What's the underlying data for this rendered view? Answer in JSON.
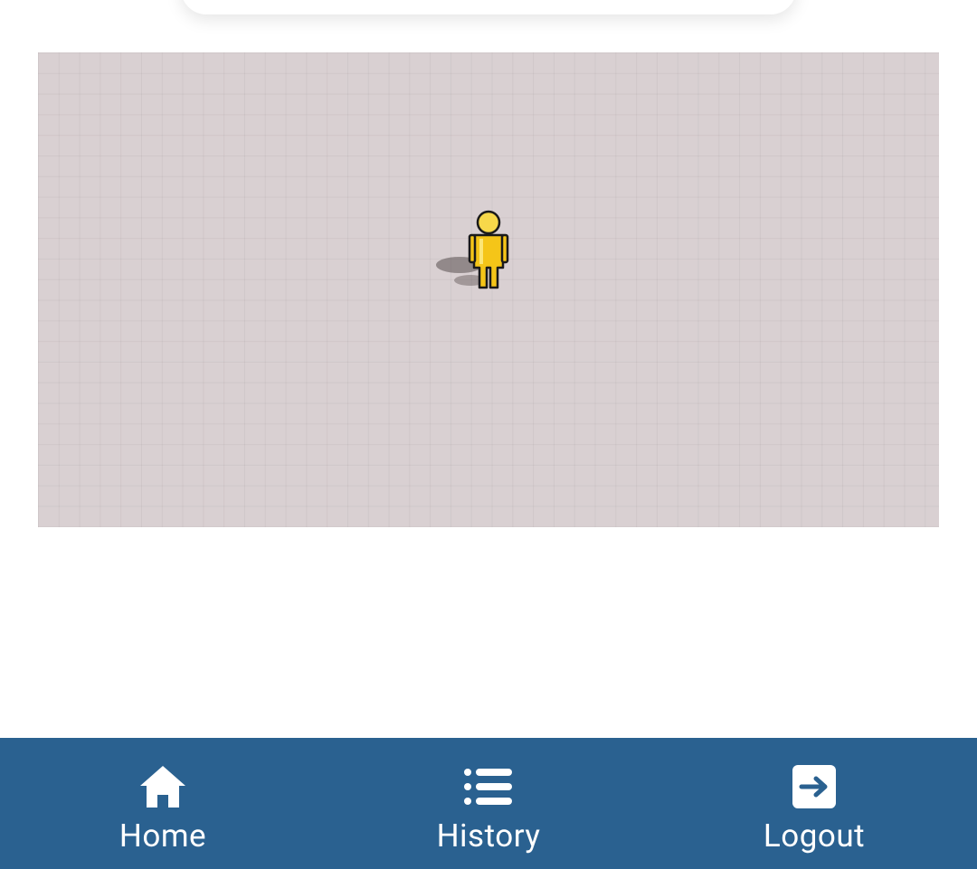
{
  "map": {
    "marker_icon": "pegman-icon",
    "background_color": "#d9d0d2"
  },
  "bottom_nav": {
    "background_color": "#2a6190",
    "items": [
      {
        "label": "Home",
        "icon": "home-icon"
      },
      {
        "label": "History",
        "icon": "list-icon"
      },
      {
        "label": "Logout",
        "icon": "logout-icon"
      }
    ]
  }
}
